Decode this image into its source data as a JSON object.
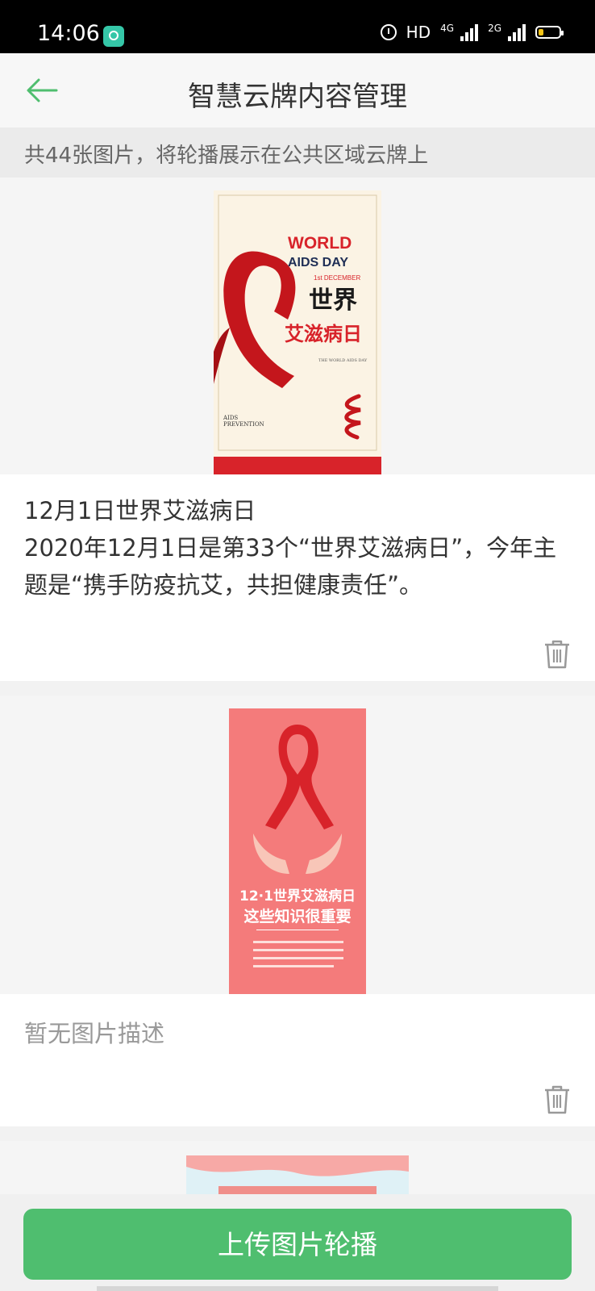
{
  "status_bar": {
    "time": "14:06",
    "hd_label": "HD",
    "net1_label": "4G",
    "net2_label": "2G",
    "icons": [
      "app-icon",
      "alarm-icon",
      "signal-icon",
      "battery-icon"
    ]
  },
  "header": {
    "title": "智慧云牌内容管理",
    "back_icon": "arrow-left-icon"
  },
  "info": {
    "text": "共44张图片，将轮播展示在公共区域云牌上"
  },
  "cards": [
    {
      "poster": {
        "title_line1": "WORLD",
        "title_line2": "AIDS DAY",
        "date": "1st DECEMBER",
        "cn_title_1": "世界",
        "cn_title_2": "艾滋病日",
        "sub_title": "THE WORLD AIDS DAY",
        "prevention_1": "AIDS",
        "prevention_2": "PREVENTION"
      },
      "desc_lines": [
        "12月1日世界艾滋病日",
        "2020年12月1日是第33个“世界艾滋病日”，今年主题是“携手防疫抗艾，共担健康责任”。"
      ]
    },
    {
      "poster": {
        "line1": "12·1世界艾滋病日",
        "line2": "这些知识很重要"
      },
      "desc_empty": "暂无图片描述"
    }
  ],
  "bottom": {
    "upload_label": "上传图片轮播"
  },
  "colors": {
    "accent_green": "#4fbe6f",
    "poster_red": "#d8232a",
    "poster_pink": "#f47b7b"
  }
}
